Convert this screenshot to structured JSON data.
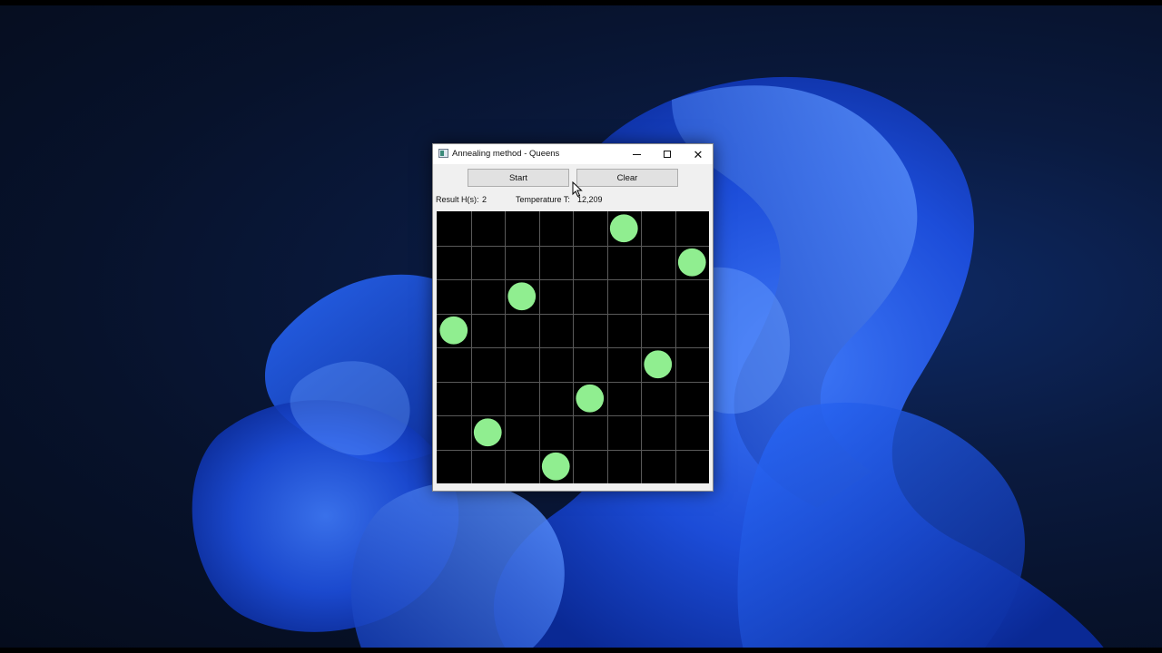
{
  "window": {
    "title": "Annealing method - Queens",
    "controls": {
      "minimize_icon": "minimize-icon",
      "maximize_icon": "maximize-icon",
      "close_icon": "close-icon"
    }
  },
  "toolbar": {
    "start_label": "Start",
    "clear_label": "Clear"
  },
  "status": {
    "result_label": "Result H(s):",
    "result_value": "2",
    "temperature_label": "Temperature T:",
    "temperature_value": "12,209"
  },
  "board": {
    "size": 8,
    "background_color": "#000000",
    "grid_color": "#5a5a5a",
    "queen_color": "#90ee90",
    "queens": [
      {
        "row": 0,
        "col": 5
      },
      {
        "row": 1,
        "col": 7
      },
      {
        "row": 2,
        "col": 2
      },
      {
        "row": 3,
        "col": 0
      },
      {
        "row": 4,
        "col": 6
      },
      {
        "row": 5,
        "col": 4
      },
      {
        "row": 6,
        "col": 1
      },
      {
        "row": 7,
        "col": 3
      }
    ]
  },
  "desktop": {
    "wallpaper": "windows-11-bloom",
    "accent_color": "#1f4fd8"
  }
}
